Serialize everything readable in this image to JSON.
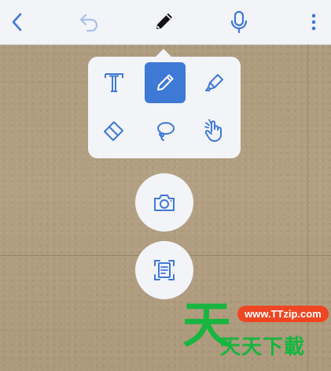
{
  "toolbar": {
    "back_icon": "chevron-left-icon",
    "undo_icon": "undo-icon",
    "markup_icon": "pencil-icon",
    "dictate_icon": "microphone-icon",
    "more_icon": "more-vertical-icon"
  },
  "tools": [
    {
      "name": "text-tool",
      "icon": "text-icon",
      "active": false
    },
    {
      "name": "pen-tool",
      "icon": "pencil-icon",
      "active": true
    },
    {
      "name": "highlighter-tool",
      "icon": "highlighter-icon",
      "active": false
    },
    {
      "name": "eraser-tool",
      "icon": "eraser-icon",
      "active": false
    },
    {
      "name": "lasso-tool",
      "icon": "lasso-icon",
      "active": false
    },
    {
      "name": "hand-tool",
      "icon": "hand-icon",
      "active": false
    }
  ],
  "actions": {
    "camera_icon": "camera-icon",
    "scan_icon": "scan-document-icon"
  },
  "watermark": {
    "big_char": "天",
    "url": "www.TTzip.com",
    "subtitle": "天天下載"
  },
  "colors": {
    "accent": "#3f79d6",
    "icon": "#3f79d6",
    "toolbar_bg": "#f2f4f8",
    "watermark_green": "#16b63f",
    "watermark_red": "#ee4623"
  }
}
